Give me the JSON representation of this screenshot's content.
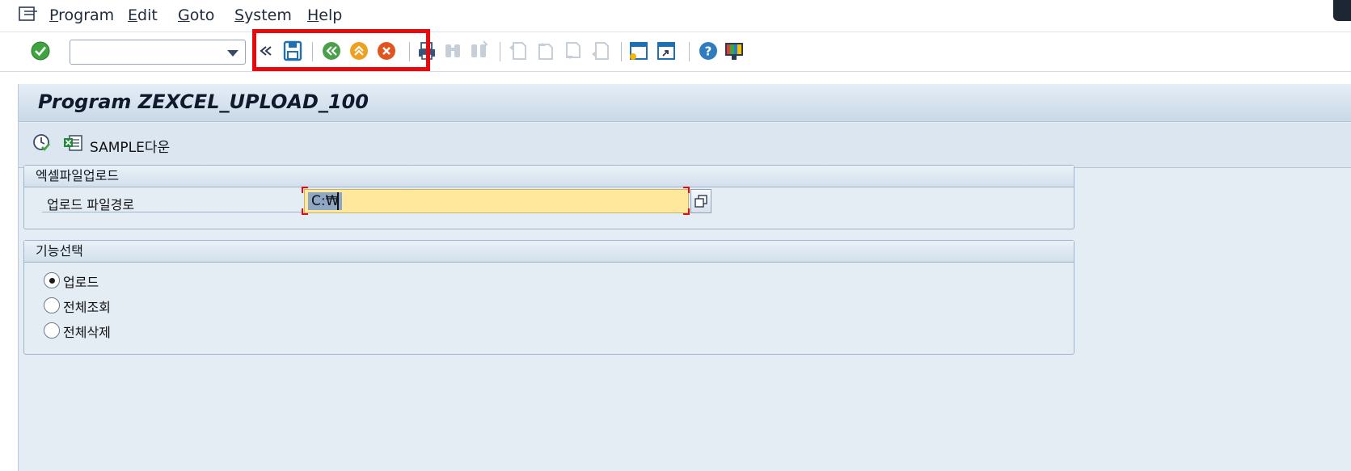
{
  "menu": {
    "items": [
      "Program",
      "Edit",
      "Goto",
      "System",
      "Help"
    ]
  },
  "toolbar": {
    "command_field_value": "",
    "icons": [
      "enter-icon",
      "back-double-arrow-icon",
      "save-icon",
      "back-icon",
      "exit-icon",
      "cancel-icon",
      "print-icon",
      "find-icon",
      "find-next-icon",
      "first-page-icon",
      "previous-page-icon",
      "next-page-icon",
      "last-page-icon",
      "create-session-icon",
      "create-shortcut-icon",
      "help-icon",
      "layout-menu-icon"
    ]
  },
  "screen": {
    "title": "Program ZEXCEL_UPLOAD_100",
    "app_toolbar": {
      "sample_button_label": "SAMPLE다운"
    }
  },
  "upload_group": {
    "title": "엑셀파일업로드",
    "path_label": "업로드 파일경로",
    "path_value": "C:₩"
  },
  "function_group": {
    "title": "기능선택",
    "options": [
      {
        "label": "업로드",
        "selected": true
      },
      {
        "label": "전체조회",
        "selected": false
      },
      {
        "label": "전체삭제",
        "selected": false
      }
    ]
  },
  "colors": {
    "highlight_box": "#e8090c",
    "input_required": "#ffe79b",
    "work_area": "#e4ecf4"
  }
}
